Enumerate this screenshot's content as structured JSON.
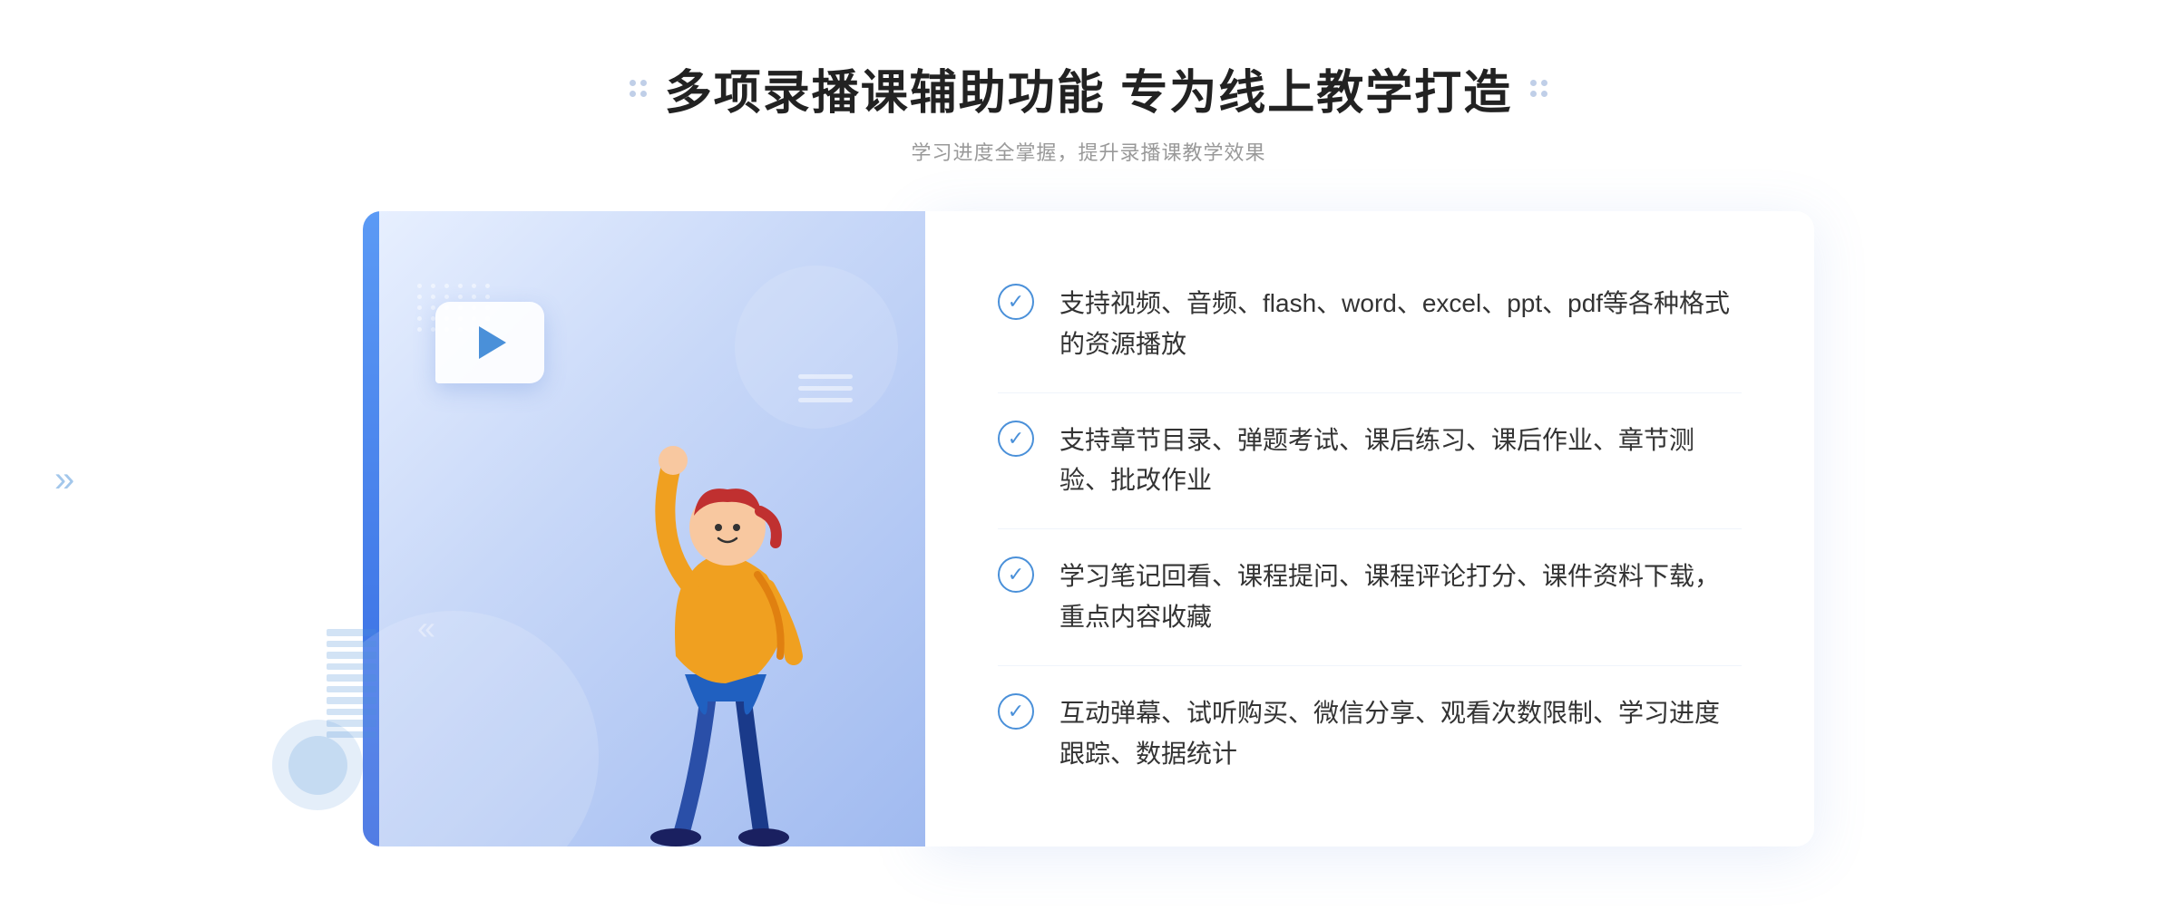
{
  "header": {
    "main_title": "多项录播课辅助功能 专为线上教学打造",
    "sub_title": "学习进度全掌握，提升录播课教学效果"
  },
  "features": [
    {
      "id": "feature-1",
      "text": "支持视频、音频、flash、word、excel、ppt、pdf等各种格式的资源播放"
    },
    {
      "id": "feature-2",
      "text": "支持章节目录、弹题考试、课后练习、课后作业、章节测验、批改作业"
    },
    {
      "id": "feature-3",
      "text": "学习笔记回看、课程提问、课程评论打分、课件资料下载，重点内容收藏"
    },
    {
      "id": "feature-4",
      "text": "互动弹幕、试听购买、微信分享、观看次数限制、学习进度跟踪、数据统计"
    }
  ],
  "colors": {
    "accent": "#4a90d9",
    "title": "#222222",
    "subtitle": "#999999",
    "text": "#333333",
    "bg_gradient_start": "#e8f0ff",
    "bg_gradient_end": "#a0baf0"
  },
  "icons": {
    "check": "✓",
    "play": "▶",
    "chevron_left": "«",
    "dots_left": "⁝⁝",
    "dots_right": "⁝⁝"
  }
}
